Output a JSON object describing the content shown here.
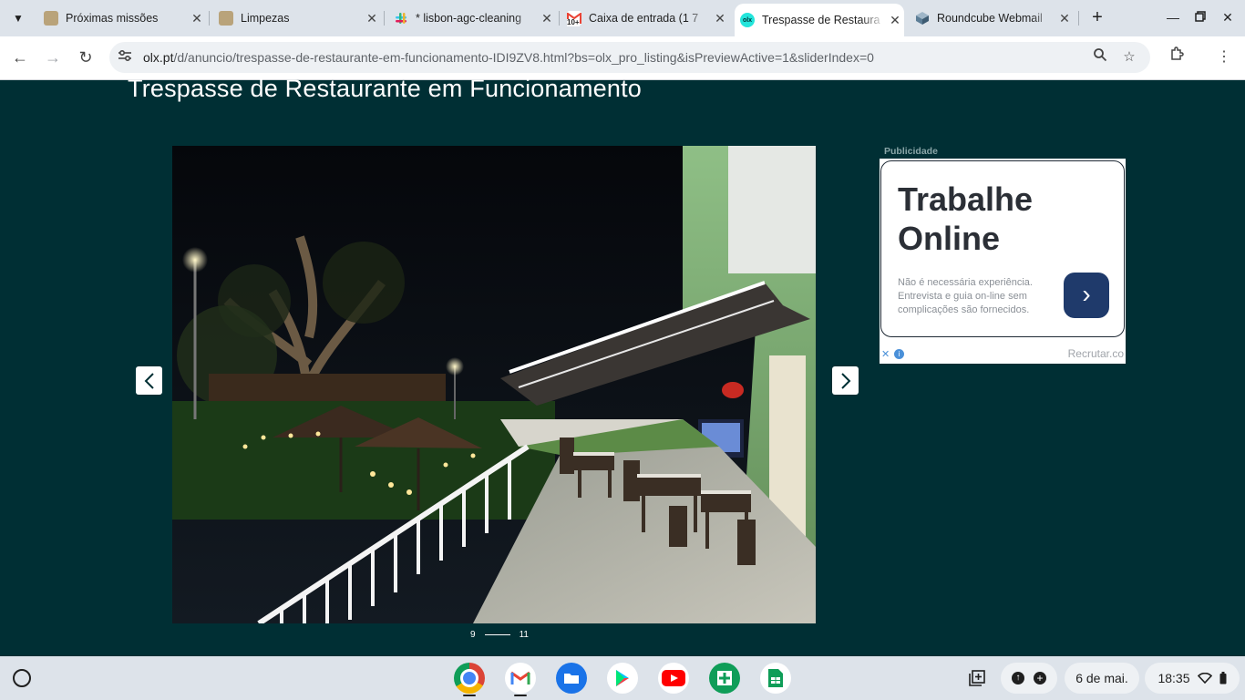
{
  "browser": {
    "tabs": [
      {
        "title": "Próximas missões",
        "icon": "tasks-app-icon",
        "active": false
      },
      {
        "title": "Limpezas",
        "icon": "tasks-app-icon",
        "active": false
      },
      {
        "title": "* lisbon-agc-cleaning",
        "icon": "slack-icon",
        "active": false
      },
      {
        "title": "Caixa de entrada (1 7",
        "icon": "gmail-icon",
        "badge": "10+",
        "active": false
      },
      {
        "title": "Trespasse de Restaura",
        "icon": "olx-icon",
        "badge": "olx",
        "active": true
      },
      {
        "title": "Roundcube Webmail",
        "icon": "roundcube-icon",
        "active": false
      }
    ],
    "url_host": "olx.pt",
    "url_path": "/d/anuncio/trespasse-de-restaurante-em-funcionamento-IDI9ZV8.html?bs=olx_pro_listing&isPreviewActive=1&sliderIndex=0"
  },
  "listing": {
    "title": "Trespasse de Restaurante em Funcionamento",
    "photo_description": "Night photo of restaurant terrace with umbrellas, string lights, tables and a TV",
    "pager": {
      "current": "9",
      "total": "11"
    }
  },
  "ad": {
    "label": "Publicidade",
    "headline": "Trabalhe Online",
    "subtext": "Não é necessária experiência. Entrevista e guia on-line sem complicações são fornecidos.",
    "brand": "Recrutar.co"
  },
  "shelf": {
    "apps": [
      "chrome",
      "gmail",
      "files",
      "play-store",
      "youtube",
      "sheets-add-on",
      "google-sheets"
    ],
    "date": "6 de mai.",
    "time": "18:35"
  },
  "colors": {
    "page_bg": "#002f34",
    "tab_strip": "#dde3ea",
    "ad_button": "#1f3a6b"
  }
}
